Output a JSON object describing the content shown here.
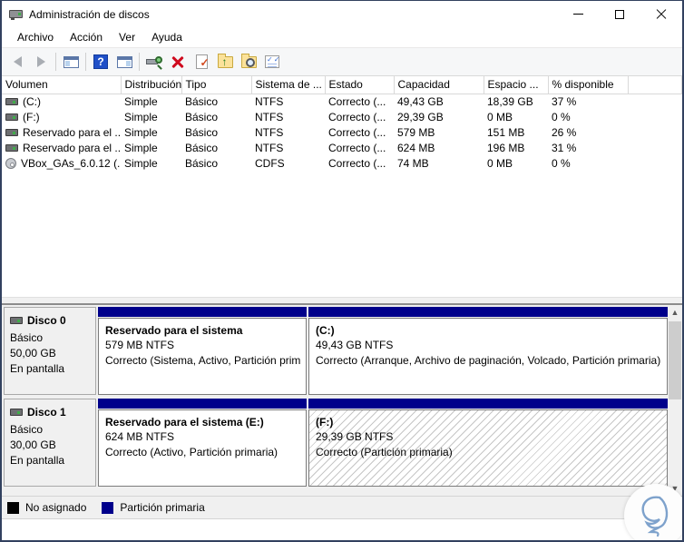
{
  "window": {
    "title": "Administración de discos"
  },
  "menu": {
    "items": [
      "Archivo",
      "Acción",
      "Ver",
      "Ayuda"
    ]
  },
  "toolbar": {
    "icons": [
      "back-icon",
      "forward-icon",
      "show-console-tree-icon",
      "help-icon",
      "show-action-pane-icon",
      "rescan-disks-icon",
      "delete-icon",
      "properties-check-icon",
      "folder-up-icon",
      "folder-search-icon",
      "checklist-icon"
    ]
  },
  "volumes": {
    "headers": [
      "Volumen",
      "Distribución",
      "Tipo",
      "Sistema de ...",
      "Estado",
      "Capacidad",
      "Espacio ...",
      "% disponible"
    ],
    "rows": [
      {
        "icon": "disk-icon",
        "name": "(C:)",
        "layout": "Simple",
        "type": "Básico",
        "fs": "NTFS",
        "status": "Correcto (...",
        "capacity": "49,43 GB",
        "free": "18,39 GB",
        "pct": "37 %"
      },
      {
        "icon": "disk-icon",
        "name": "(F:)",
        "layout": "Simple",
        "type": "Básico",
        "fs": "NTFS",
        "status": "Correcto (...",
        "capacity": "29,39 GB",
        "free": "0 MB",
        "pct": "0 %"
      },
      {
        "icon": "disk-icon",
        "name": "Reservado para el ...",
        "layout": "Simple",
        "type": "Básico",
        "fs": "NTFS",
        "status": "Correcto (...",
        "capacity": "579 MB",
        "free": "151 MB",
        "pct": "26 %"
      },
      {
        "icon": "disk-icon",
        "name": "Reservado para el ...",
        "layout": "Simple",
        "type": "Básico",
        "fs": "NTFS",
        "status": "Correcto (...",
        "capacity": "624 MB",
        "free": "196 MB",
        "pct": "31 %"
      },
      {
        "icon": "cd-icon",
        "name": "VBox_GAs_6.0.12 (...",
        "layout": "Simple",
        "type": "Básico",
        "fs": "CDFS",
        "status": "Correcto (...",
        "capacity": "74 MB",
        "free": "0 MB",
        "pct": "0 %"
      }
    ]
  },
  "disks": [
    {
      "label": "Disco 0",
      "type": "Básico",
      "size": "50,00 GB",
      "status": "En pantalla",
      "partitions": [
        {
          "name": "Reservado para el sistema",
          "size": "579 MB NTFS",
          "status": "Correcto (Sistema, Activo, Partición prim"
        },
        {
          "name": "(C:)",
          "size": "49,43 GB NTFS",
          "status": "Correcto (Arranque, Archivo de paginación, Volcado, Partición primaria)"
        }
      ]
    },
    {
      "label": "Disco 1",
      "type": "Básico",
      "size": "30,00 GB",
      "status": "En pantalla",
      "partitions": [
        {
          "name": "Reservado para el sistema (E:)",
          "size": "624 MB NTFS",
          "status": "Correcto (Activo, Partición primaria)"
        },
        {
          "name": "(F:)",
          "size": "29,39 GB NTFS",
          "status": "Correcto (Partición primaria)"
        }
      ]
    }
  ],
  "legend": {
    "items": [
      {
        "label": "No asignado",
        "color": "#000000"
      },
      {
        "label": "Partición primaria",
        "color": "#00008b"
      }
    ]
  },
  "colors": {
    "partition_header": "#00008b",
    "window_border": "#32415f"
  },
  "watermark_icon": "speech-bubble-logo"
}
